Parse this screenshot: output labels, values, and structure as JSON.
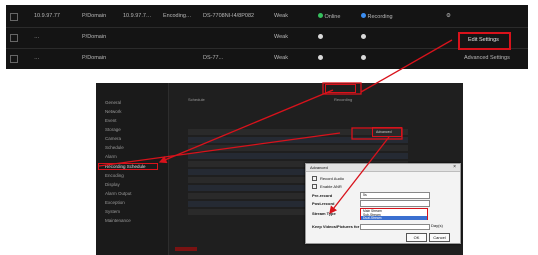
{
  "devices": [
    {
      "ip": "10.9.97.77",
      "domain": "P/Domain",
      "addr": "10.9.97.7…",
      "encoding": "Encoding…",
      "model": "DS-7708NI-I4/8P082",
      "signal": "Weak",
      "status": "Online",
      "record": "Recording",
      "action": "Edit Settings"
    },
    {
      "ip": "…",
      "domain": "P/Domain",
      "addr": "…",
      "encoding": "…",
      "model": "…",
      "signal": "Weak",
      "status": "…",
      "record": "…",
      "action": "Edit Settings"
    },
    {
      "ip": "…",
      "domain": "P/Domain",
      "addr": "…",
      "encoding": "…",
      "model": "DS-77...",
      "signal": "Weak",
      "status": "…",
      "record": "…",
      "action": "Advanced Settings"
    }
  ],
  "highlight_label": "Edit Settings",
  "sidebar": [
    "General",
    "Network",
    "Event",
    "Storage",
    "Camera",
    "Schedule",
    "Alarm",
    "Privacy",
    "Recording Schedule",
    "Encoding",
    "Display",
    "Alarm Output",
    "Exception",
    "System",
    "Maintenance"
  ],
  "settings": {
    "tab_label": "Recording",
    "advanced_button": "Advanced",
    "schedule_label": "Schedule"
  },
  "dialog": {
    "title": "Advanced",
    "options": [
      "Record Audio",
      "Enable ANR"
    ],
    "pre_record_label": "Pre-record",
    "pre_record_value": "5s",
    "post_record_label": "Post-record",
    "stream_type_label": "Stream Type",
    "keep_label": "Keep Videos/Pictures for",
    "stream_options": [
      "Main Stream",
      "Sub-Stream",
      "Dual-Stream"
    ],
    "day_unit": "Day(s)",
    "ok": "OK",
    "cancel": "Cancel"
  },
  "colors": {
    "accent_red": "#d8121b",
    "online_green": "#36c05e",
    "record_blue": "#3b8ef2"
  }
}
